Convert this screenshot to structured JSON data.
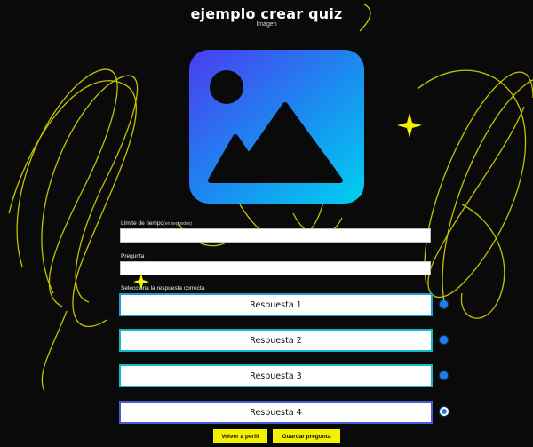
{
  "header": {
    "title": "ejemplo crear quiz",
    "subtitle": "Imagen"
  },
  "image_placeholder": {
    "icon": "image-icon"
  },
  "form": {
    "time_limit": {
      "label": "Límite de tiempo",
      "hint": "(en segundos)",
      "value": ""
    },
    "question": {
      "label": "Pregunta",
      "value": ""
    },
    "answers_label": "Selecciona la respuesta correcta",
    "answers": [
      {
        "label": "Respuesta 1",
        "selected": false
      },
      {
        "label": "Respuesta 2",
        "selected": false
      },
      {
        "label": "Respuesta 3",
        "selected": false
      },
      {
        "label": "Respuesta 4",
        "selected": true
      }
    ]
  },
  "actions": {
    "back_label": "Volver a perfil",
    "save_label": "Guardar pregunta"
  },
  "colors": {
    "background": "#0a0a0a",
    "accent_yellow": "#f2f200",
    "swirl": "#d8d800",
    "icon_gradient_start": "#4a3cf0",
    "icon_gradient_end": "#00c8f0"
  }
}
